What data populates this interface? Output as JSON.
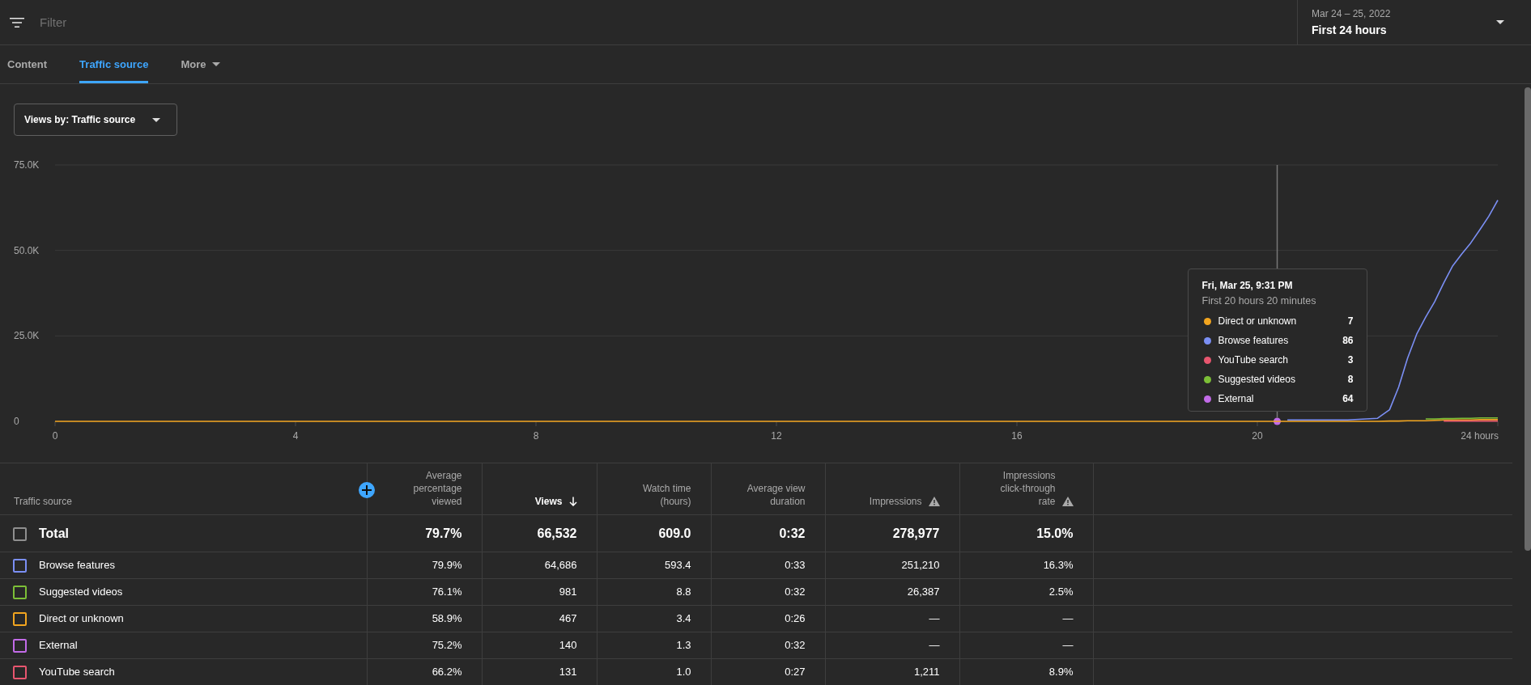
{
  "filter_bar": {
    "placeholder": "Filter"
  },
  "date_range": {
    "range": "Mar 24 – 25, 2022",
    "period": "First 24 hours"
  },
  "tabs": [
    {
      "label": "Content",
      "kind": "tab",
      "selected": false
    },
    {
      "label": "Traffic source",
      "kind": "tab",
      "selected": true
    },
    {
      "label": "More",
      "kind": "menu",
      "selected": false
    }
  ],
  "chart": {
    "dropdown": "Views by: Traffic source",
    "chart_data": {
      "type": "line",
      "legend": "right",
      "x": [
        0,
        4,
        8,
        12,
        16,
        20,
        20.33,
        20.5,
        21,
        21.5,
        22,
        22.2,
        22.35,
        22.5,
        22.65,
        22.8,
        22.95,
        23.1,
        23.25,
        23.4,
        23.55,
        23.7,
        23.85,
        24
      ],
      "xlim": [
        0,
        24
      ],
      "ylim": [
        0,
        75000
      ],
      "xticks": [
        0,
        4,
        8,
        12,
        16,
        20,
        {
          "value": 24,
          "label": "24 hours"
        }
      ],
      "yticks": [
        0,
        {
          "value": 25000,
          "label": "25.0K"
        },
        {
          "value": 50000,
          "label": "50.0K"
        },
        {
          "value": 75000,
          "label": "75.0K"
        }
      ],
      "series": [
        {
          "name": "Direct or unknown",
          "color": "#f2a51f",
          "values": [
            0,
            0,
            0,
            0,
            0,
            0,
            0,
            0,
            0,
            0,
            0,
            100,
            100,
            200,
            200,
            200,
            300,
            400,
            400,
            400,
            400,
            500,
            500,
            500
          ]
        },
        {
          "name": "Browse features",
          "color": "#7b8ff4",
          "values": [
            null,
            null,
            null,
            null,
            null,
            null,
            null,
            400,
            400,
            400,
            900,
            3400,
            10000,
            18500,
            25500,
            30500,
            35000,
            40500,
            45500,
            49000,
            52200,
            56000,
            60000,
            64700
          ]
        },
        {
          "name": "YouTube search",
          "color": "#e8566f",
          "values": [
            null,
            null,
            null,
            null,
            null,
            null,
            null,
            null,
            null,
            null,
            null,
            null,
            null,
            null,
            null,
            null,
            null,
            100,
            100,
            100,
            100,
            100,
            100,
            100
          ]
        },
        {
          "name": "Suggested videos",
          "color": "#7cbf37",
          "values": [
            null,
            null,
            null,
            null,
            null,
            null,
            null,
            null,
            null,
            null,
            null,
            null,
            null,
            null,
            null,
            700,
            700,
            800,
            800,
            900,
            900,
            1000,
            1000,
            1000
          ]
        },
        {
          "name": "External",
          "color": "#c26be8",
          "marker": "circle",
          "values": [
            null,
            null,
            null,
            null,
            null,
            null,
            0,
            null,
            null,
            null,
            null,
            null,
            null,
            null,
            null,
            null,
            null,
            null,
            null,
            null,
            null,
            null,
            null,
            null
          ]
        }
      ],
      "annotations": [
        "Fri, Mar 25, 9:31 PM"
      ]
    },
    "tooltip": {
      "subtitle": "First 20 hours 20 minutes",
      "values": [
        "7",
        "86",
        "3",
        "8",
        "64"
      ]
    }
  },
  "table": {
    "columns": [
      {
        "label": "Traffic source",
        "sorted": false,
        "warning": false
      },
      {
        "label": "Average percentage viewed",
        "sorted": false,
        "warning": false
      },
      {
        "label": "Views",
        "sorted": true,
        "warning": false
      },
      {
        "label": "Watch time (hours)",
        "sorted": false,
        "warning": false
      },
      {
        "label": "Average view duration",
        "sorted": false,
        "warning": false
      },
      {
        "label": "Impressions",
        "sorted": false,
        "warning": true
      },
      {
        "label": "Impressions click-through rate",
        "sorted": false,
        "warning": true
      }
    ],
    "total": {
      "checked": false,
      "cells": [
        "Total",
        "79.7%",
        "66,532",
        "609.0",
        "0:32",
        "278,977",
        "15.0%"
      ]
    },
    "rows": [
      {
        "color": "#7b8ff4",
        "checked": false,
        "cells": [
          "Browse features",
          "79.9%",
          "64,686",
          "593.4",
          "0:33",
          "251,210",
          "16.3%"
        ]
      },
      {
        "color": "#7cbf37",
        "checked": false,
        "cells": [
          "Suggested videos",
          "76.1%",
          "981",
          "8.8",
          "0:32",
          "26,387",
          "2.5%"
        ]
      },
      {
        "color": "#f2a51f",
        "checked": false,
        "cells": [
          "Direct or unknown",
          "58.9%",
          "467",
          "3.4",
          "0:26",
          "—",
          "—"
        ]
      },
      {
        "color": "#c26be8",
        "checked": false,
        "cells": [
          "External",
          "75.2%",
          "140",
          "1.3",
          "0:32",
          "—",
          "—"
        ]
      },
      {
        "color": "#e8566f",
        "checked": false,
        "cells": [
          "YouTube search",
          "66.2%",
          "131",
          "1.0",
          "0:27",
          "1,211",
          "8.9%"
        ]
      }
    ]
  }
}
